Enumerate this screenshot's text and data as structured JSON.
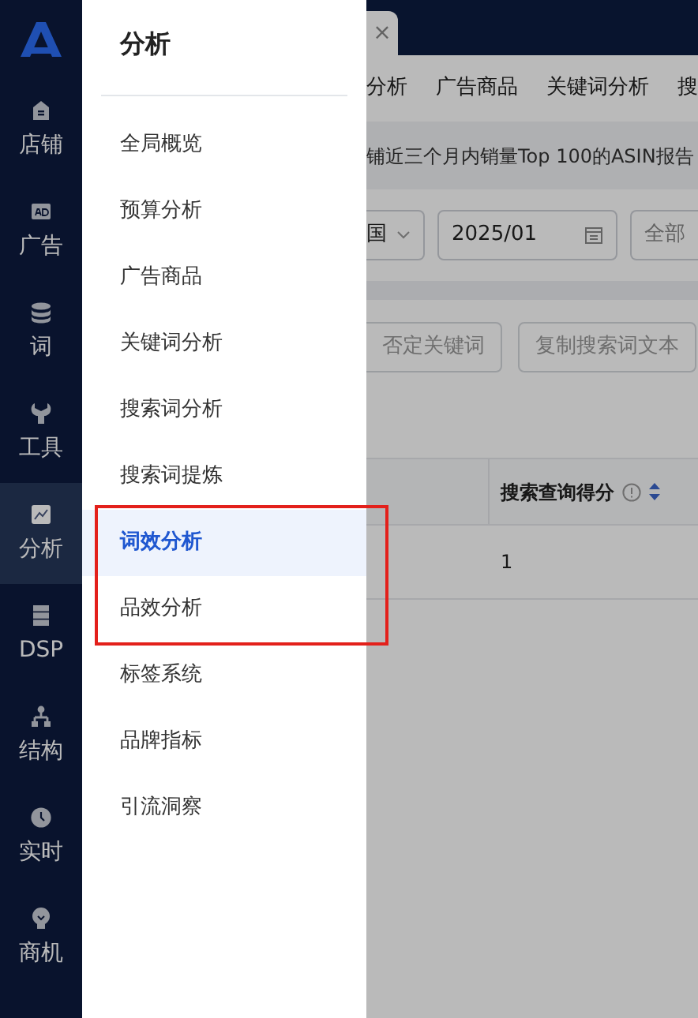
{
  "rail": {
    "items": [
      {
        "label": "店铺",
        "selected": false
      },
      {
        "label": "广告",
        "selected": false
      },
      {
        "label": "词",
        "selected": false
      },
      {
        "label": "工具",
        "selected": false
      },
      {
        "label": "分析",
        "selected": true
      },
      {
        "label": "DSP",
        "selected": false
      },
      {
        "label": "结构",
        "selected": false
      },
      {
        "label": "实时",
        "selected": false
      },
      {
        "label": "商机",
        "selected": false
      }
    ]
  },
  "flyout": {
    "title": "分析",
    "items": [
      {
        "label": "全局概览",
        "selected": false
      },
      {
        "label": "预算分析",
        "selected": false
      },
      {
        "label": "广告商品",
        "selected": false
      },
      {
        "label": "关键词分析",
        "selected": false
      },
      {
        "label": "搜索词分析",
        "selected": false
      },
      {
        "label": "搜索词提炼",
        "selected": false
      },
      {
        "label": "词效分析",
        "selected": true
      },
      {
        "label": "品效分析",
        "selected": false
      },
      {
        "label": "标签系统",
        "selected": false
      },
      {
        "label": "品牌指标",
        "selected": false
      },
      {
        "label": "引流洞察",
        "selected": false
      }
    ]
  },
  "background": {
    "tab_close": "×",
    "nav_tabs": [
      "分析",
      "广告商品",
      "关键词分析",
      "搜"
    ],
    "notice": "铺近三个月内销量Top 100的ASIN报告",
    "filters": [
      {
        "kind": "select",
        "value": "国"
      },
      {
        "kind": "date",
        "value": "2025/01"
      },
      {
        "kind": "select-cut",
        "placeholder": "全部"
      }
    ],
    "buttons": [
      "否定关键词",
      "复制搜索词文本"
    ],
    "table": {
      "columns": [
        "搜索查询得分"
      ],
      "rows": [
        [
          "1"
        ]
      ]
    }
  },
  "annotation": {
    "kind": "highlight-frame"
  }
}
